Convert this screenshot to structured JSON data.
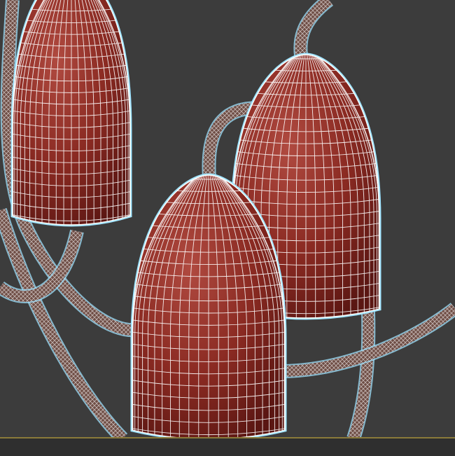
{
  "viewport": {
    "view": "3d-wireframe-shaded",
    "background_color": "#3c3c3c",
    "ground_line_color": "#8a7a3a",
    "wire_color": "#ffffff",
    "selection_glow_color": "#9fe3ff",
    "shade_color_light": "#b04a40",
    "shade_color_dark": "#5a1612",
    "objects": [
      {
        "name": "lamp-shade-front"
      },
      {
        "name": "lamp-shade-back"
      },
      {
        "name": "lamp-shade-left"
      },
      {
        "name": "cable-tubes"
      }
    ]
  }
}
